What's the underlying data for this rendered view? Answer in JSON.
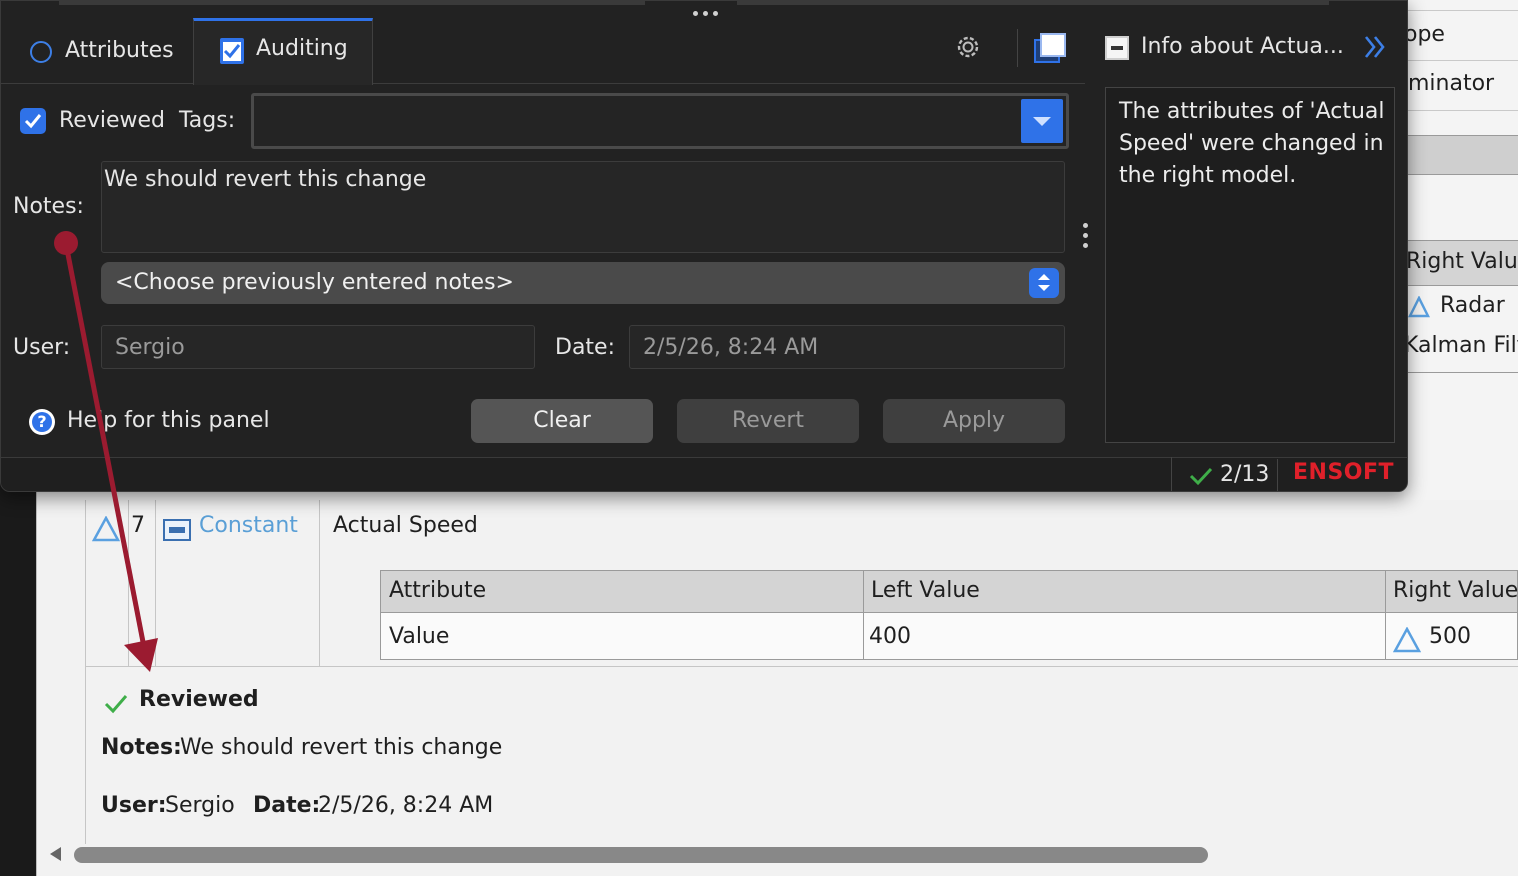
{
  "panel": {
    "tabs": [
      {
        "label": "Attributes",
        "active": false
      },
      {
        "label": "Auditing",
        "active": true
      }
    ],
    "info_title": "Info about Actua...",
    "info_text": "The attributes of 'Actual Speed' were changed in the right model.",
    "reviewed_label": "Reviewed",
    "reviewed_checked": true,
    "tags_label": "Tags:",
    "tags_value": "",
    "notes_label": "Notes:",
    "notes_value": "We should revert this change",
    "prev_notes_option": "<Choose previously entered notes>",
    "user_label": "User:",
    "user_value": "Sergio",
    "date_label": "Date:",
    "date_value": "2/5/26, 8:24 AM",
    "help_label": "Help for this panel",
    "buttons": {
      "clear": "Clear",
      "revert": "Revert",
      "apply": "Apply"
    },
    "status": {
      "count": "2/13",
      "brand": "ENSOFT"
    },
    "colors": {
      "accent": "#2f72e8",
      "brand": "#e0202a",
      "check": "#3fae49"
    }
  },
  "background": {
    "strip": [
      "ope",
      "minator",
      "Right Value",
      "Radar",
      "Kalman Filt"
    ],
    "row_index": "7",
    "row_type": "Constant",
    "row_name": "Actual Speed",
    "table": {
      "headers": [
        "Attribute",
        "Left Value",
        "Right Value"
      ],
      "rows": [
        [
          "Value",
          "400",
          "500"
        ]
      ]
    },
    "review": {
      "status": "Reviewed",
      "notes_label": "Notes:",
      "notes_value": "We should revert this change",
      "user_label": "User:",
      "user_value": "Sergio",
      "date_label": "Date:",
      "date_value": "2/5/26, 8:24 AM"
    }
  }
}
